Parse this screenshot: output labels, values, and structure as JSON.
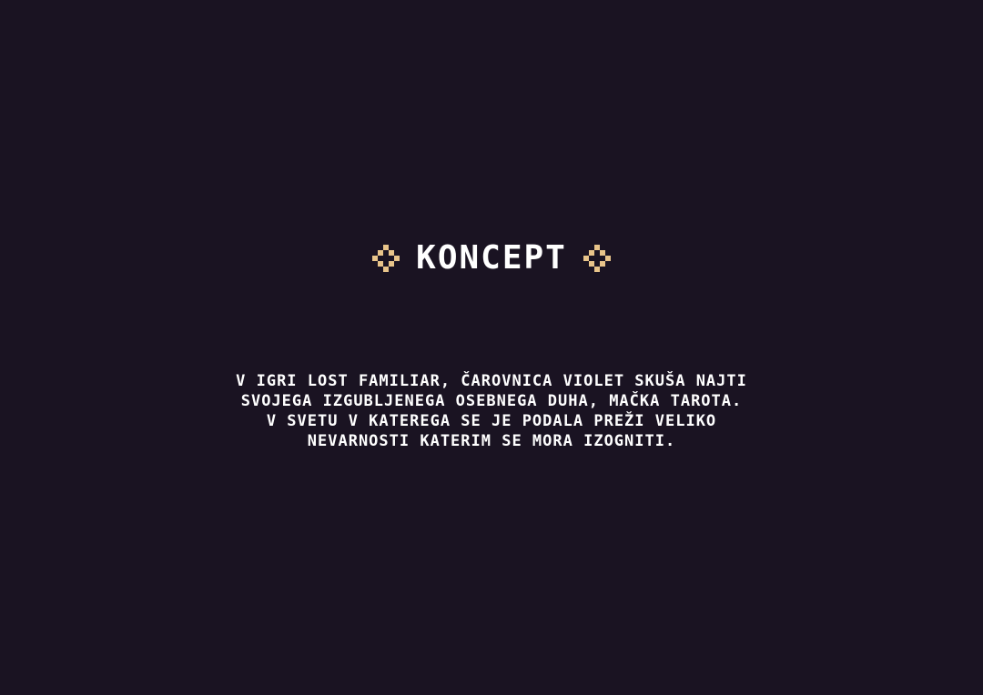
{
  "colors": {
    "background": "#1a1322",
    "text": "#ffffff",
    "ornament": "#e8c48a"
  },
  "header": {
    "title": "KONCEPT",
    "left_icon": "diamond-ornament-icon",
    "right_icon": "diamond-ornament-icon"
  },
  "concept": {
    "lines": [
      "V IGRI LOST FAMILIAR, ČAROVNICA VIOLET SKUŠA NAJTI",
      "SVOJEGA IZGUBLJENEGA OSEBNEGA DUHA, MAČKA TAROTA.",
      "V SVETU V KATEREGA SE JE PODALA PREŽI VELIKO",
      "NEVARNOSTI KATERIM SE MORA IZOGNITI."
    ]
  }
}
